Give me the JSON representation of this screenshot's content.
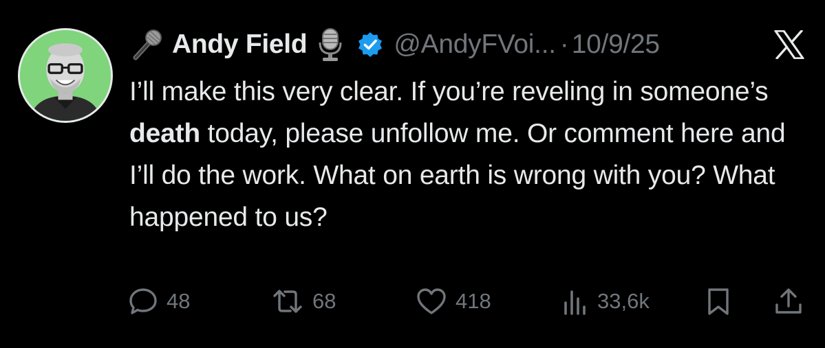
{
  "tweet": {
    "author_emoji_prefix": "microphone-emoji",
    "author_name": "Andy Field",
    "author_emoji_suffix": "studio-microphone-emoji",
    "verified": true,
    "handle": "@AndyFVoi...",
    "separator": "·",
    "date": "10/9/25",
    "text_segments": {
      "p1": "I’ll make this very clear. If you’re reveling in someone’s ",
      "bold": "death",
      "p2": " today, please unfollow me. Or comment here and I’ll do the work. What on earth is wrong with you?  What happened to us?"
    },
    "stats": {
      "replies": "48",
      "retweets": "68",
      "likes": "418",
      "views": "33,6k"
    }
  },
  "icons": {
    "platform": "x-logo-icon",
    "reply": "speech-bubble-icon",
    "retweet": "retweet-icon",
    "like": "heart-icon",
    "views": "bar-chart-icon",
    "bookmark": "bookmark-icon",
    "share": "share-upload-icon"
  },
  "colors": {
    "background": "#000000",
    "text": "#e7e9ea",
    "muted": "#71767b",
    "verified": "#1d9bf0",
    "avatar_bg": "#7fd47c"
  }
}
